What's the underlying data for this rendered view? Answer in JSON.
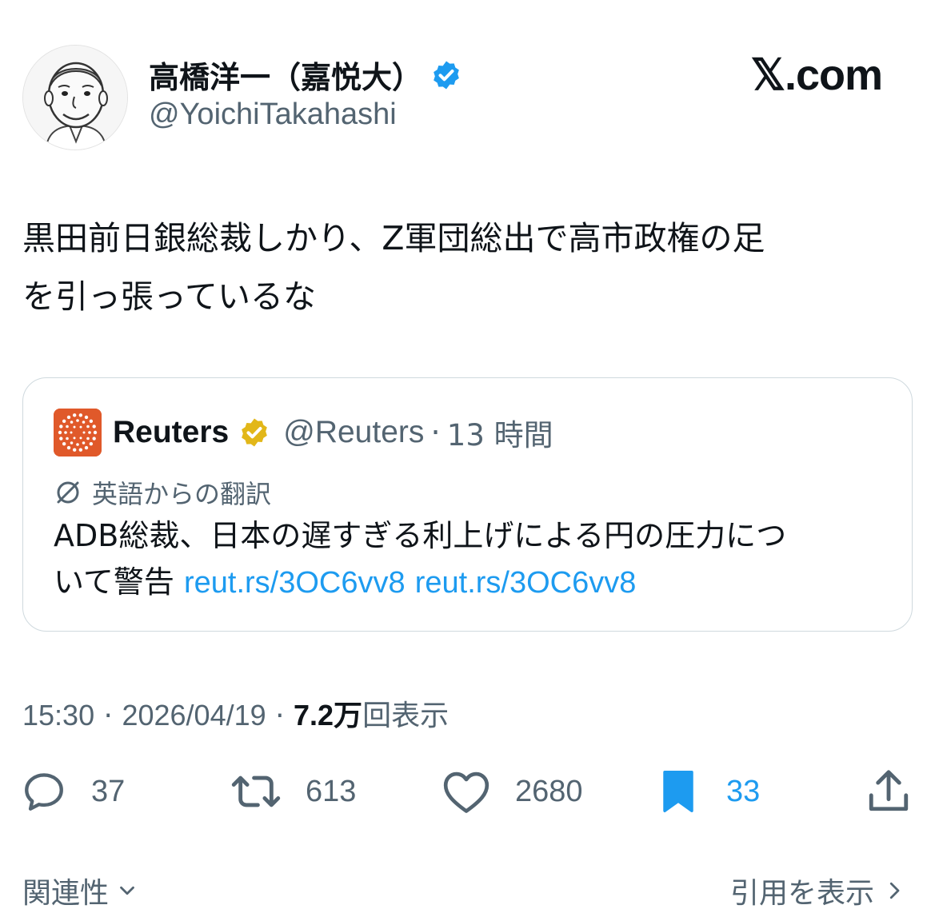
{
  "author": {
    "display_name": "高橋洋一（嘉悦大）",
    "handle": "@YoichiTakahashi",
    "verified": true
  },
  "brand": "𝕏.com",
  "tweet": {
    "text_line1": "黒田前日銀総裁しかり、Z軍団総出で高市政権の足",
    "text_line2": "を引っ張っているな"
  },
  "quote": {
    "name": "Reuters",
    "handle": "@Reuters",
    "separator": "·",
    "time": "13 時間",
    "translated_label": "英語からの翻訳",
    "body_line1": "ADB総裁、日本の遅すぎる利上げによる円の圧力につ",
    "body_line2": "いて警告",
    "link1": "reut.rs/3OC6vv8",
    "link2": "reut.rs/3OC6vv8"
  },
  "meta": {
    "time": "15:30",
    "sep1": "·",
    "date": "2026/04/19",
    "sep2": "·",
    "views_num": "7.2",
    "views_unit": "万",
    "views_label": "回表示"
  },
  "actions": {
    "replies": "37",
    "retweets": "613",
    "likes": "2680",
    "bookmarks": "33"
  },
  "footer": {
    "related": "関連性",
    "show_quotes": "引用を表示"
  },
  "colors": {
    "accent": "#1d9bf0",
    "muted": "#536471",
    "text": "#0f1419",
    "reuters_orange": "#e0592a",
    "verified_gold": "#e2b719"
  },
  "icons": [
    "avatar-illustration",
    "verified-badge-icon",
    "reuters-logo",
    "verified-gold-badge-icon",
    "translate-icon",
    "reply-icon",
    "retweet-icon",
    "like-icon",
    "bookmark-icon",
    "share-icon",
    "chevron-down-icon",
    "chevron-right-icon"
  ]
}
